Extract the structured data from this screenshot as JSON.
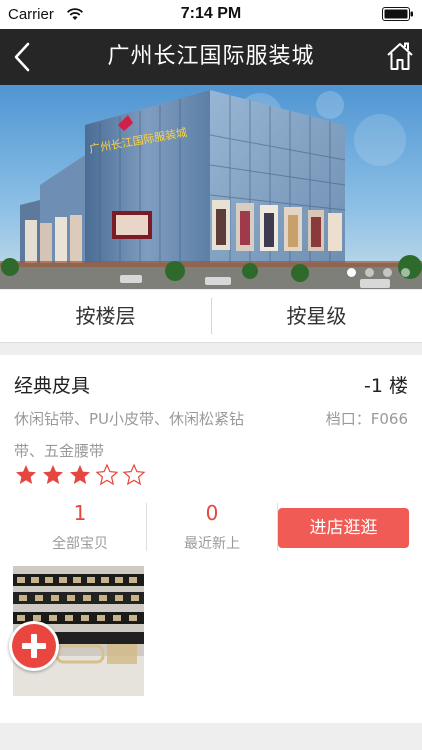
{
  "status_bar": {
    "carrier": "Carrier",
    "time": "7:14 PM",
    "wifi_icon": "wifi-icon",
    "battery_icon": "battery-icon"
  },
  "nav": {
    "title": "广州长江国际服装城",
    "back_icon": "chevron-left-icon",
    "home_icon": "home-icon"
  },
  "banner": {
    "image": "mall-building-photo",
    "building_sign": "广州长江国际服装城",
    "slide_count": 4,
    "active_slide": 0
  },
  "tabs": [
    {
      "label": "按楼层"
    },
    {
      "label": "按星级"
    }
  ],
  "shop": {
    "name": "经典皮具",
    "floor": "-1 楼",
    "description_line1": "休闲钻带、PU小皮带、休闲松紧钻",
    "description_line2": "带、五金腰带",
    "stall_label": "档口：",
    "stall_code": "F066",
    "rating": 3,
    "rating_max": 5,
    "stats": [
      {
        "value": "1",
        "label": "全部宝贝"
      },
      {
        "value": "0",
        "label": "最近新上"
      }
    ],
    "enter_button": "进店逛逛",
    "product_image": "belt-product-photo",
    "add_button_icon": "plus-icon"
  },
  "colors": {
    "nav_bg": "#262626",
    "accent_red": "#f15b55",
    "star_red": "#e5463f",
    "page_bg": "#eeeeee"
  }
}
